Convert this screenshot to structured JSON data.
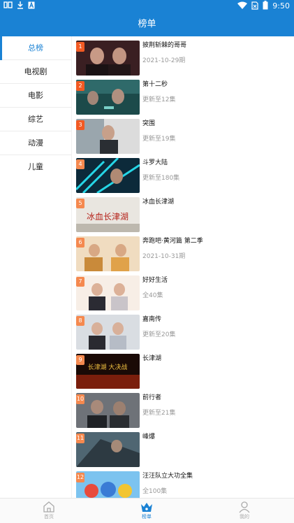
{
  "status_bar": {
    "left_icons": [
      "signal-app-icon",
      "download-icon",
      "a-icon"
    ],
    "right_icons": [
      "wifi-icon",
      "no-sim-icon",
      "battery-icon"
    ],
    "time": "9:50"
  },
  "header": {
    "title": "榜单"
  },
  "colors": {
    "primary": "#1a82d4",
    "rank_badge": "#f25a23",
    "rank_badge_light": "#f5894f"
  },
  "sidebar": {
    "items": [
      {
        "label": "总榜",
        "active": true
      },
      {
        "label": "电视剧",
        "active": false
      },
      {
        "label": "电影",
        "active": false
      },
      {
        "label": "综艺",
        "active": false
      },
      {
        "label": "动漫",
        "active": false
      },
      {
        "label": "儿童",
        "active": false
      }
    ]
  },
  "rankings": [
    {
      "rank": "1",
      "title": "披荆斩棘的哥哥",
      "subtitle": "2021-10-29期"
    },
    {
      "rank": "2",
      "title": "第十二秒",
      "subtitle": "更新至12集"
    },
    {
      "rank": "3",
      "title": "突围",
      "subtitle": "更新至19集"
    },
    {
      "rank": "4",
      "title": "斗罗大陆",
      "subtitle": "更新至180集"
    },
    {
      "rank": "5",
      "title": "冰血长津湖",
      "subtitle": "",
      "poster_text": "冰血长津湖"
    },
    {
      "rank": "6",
      "title": "奔跑吧·黄河篇 第二季",
      "subtitle": "2021-10-31期"
    },
    {
      "rank": "7",
      "title": "好好生活",
      "subtitle": "全40集"
    },
    {
      "rank": "8",
      "title": "嘉南传",
      "subtitle": "更新至20集"
    },
    {
      "rank": "9",
      "title": "长津湖",
      "subtitle": "",
      "poster_text": "长津湖 大决战"
    },
    {
      "rank": "10",
      "title": "前行者",
      "subtitle": "更新至21集"
    },
    {
      "rank": "11",
      "title": "峰爆",
      "subtitle": ""
    },
    {
      "rank": "12",
      "title": "汪汪队立大功全集",
      "subtitle": "全100集"
    }
  ],
  "bottom_nav": {
    "items": [
      {
        "label": "首页",
        "icon": "home-icon",
        "active": false
      },
      {
        "label": "榜单",
        "icon": "crown-icon",
        "active": true
      },
      {
        "label": "我的",
        "icon": "user-icon",
        "active": false
      }
    ]
  }
}
